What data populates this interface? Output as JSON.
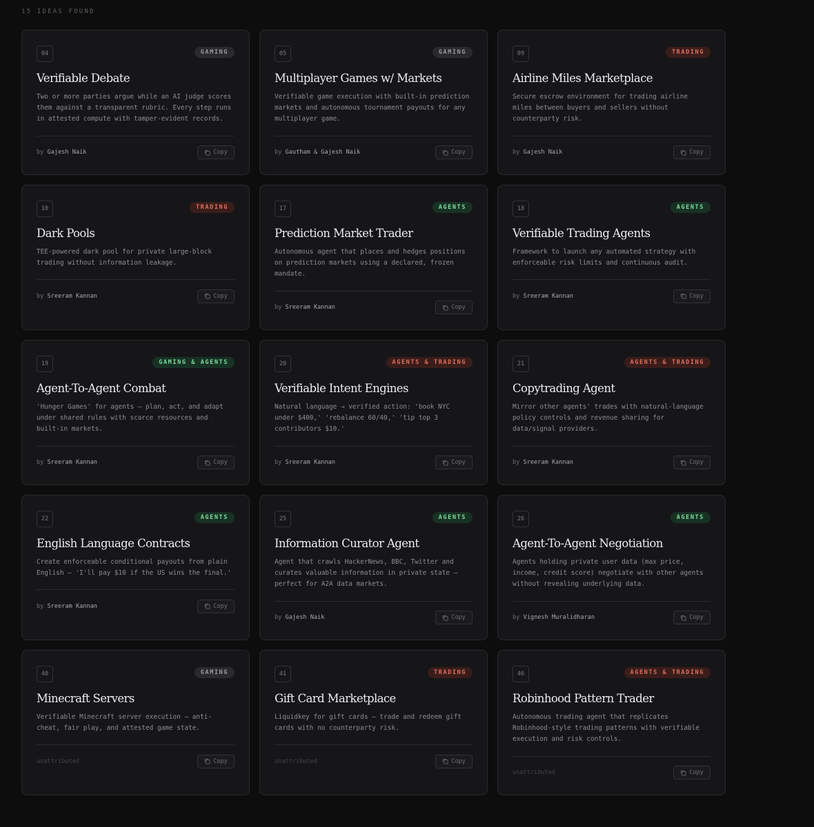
{
  "results": {
    "count_label": "15 IDEAS FOUND"
  },
  "copy_label": "Copy",
  "by_label": "by",
  "cards": [
    {
      "num": "04",
      "tag": "GAMING",
      "tag_style": "gaming",
      "title": "Verifiable Debate",
      "desc": "Two or more parties argue while an AI judge scores them against a transparent rubric. Every step runs in attested compute with tamper-evident records.",
      "author": "Gajesh Naik",
      "attributed": true
    },
    {
      "num": "05",
      "tag": "GAMING",
      "tag_style": "gaming",
      "title": "Multiplayer Games w/ Markets",
      "desc": "Verifiable game execution with built-in prediction markets and autonomous tournament payouts for any multiplayer game.",
      "author": "Gautham & Gajesh Naik",
      "attributed": true
    },
    {
      "num": "09",
      "tag": "TRADING",
      "tag_style": "trading",
      "title": "Airline Miles Marketplace",
      "desc": "Secure escrow environment for trading airline miles between buyers and sellers without counterparty risk.",
      "author": "Gajesh Naik",
      "attributed": true
    },
    {
      "num": "10",
      "tag": "TRADING",
      "tag_style": "trading",
      "title": "Dark Pools",
      "desc": "TEE-powered dark pool for private large-block trading without information leakage.",
      "author": "Sreeram Kannan",
      "attributed": true
    },
    {
      "num": "17",
      "tag": "AGENTS",
      "tag_style": "agents",
      "title": "Prediction Market Trader",
      "desc": "Autonomous agent that places and hedges positions on prediction markets using a declared, frozen mandate.",
      "author": "Sreeram Kannan",
      "attributed": true
    },
    {
      "num": "18",
      "tag": "AGENTS",
      "tag_style": "agents",
      "title": "Verifiable Trading Agents",
      "desc": "Framework to launch any automated strategy with enforceable risk limits and continuous audit.",
      "author": "Sreeram Kannan",
      "attributed": true
    },
    {
      "num": "19",
      "tag": "GAMING & AGENTS",
      "tag_style": "gaming-agents",
      "title": "Agent-To-Agent Combat",
      "desc": "'Hunger Games' for agents — plan, act, and adapt under shared rules with scarce resources and built-in markets.",
      "author": "Sreeram Kannan",
      "attributed": true
    },
    {
      "num": "20",
      "tag": "AGENTS & TRADING",
      "tag_style": "agents-trading",
      "title": "Verifiable Intent Engines",
      "desc": "Natural language → verified action: 'book NYC under $400,' 'rebalance 60/40,' 'tip top 3 contributors $10.'",
      "author": "Sreeram Kannan",
      "attributed": true
    },
    {
      "num": "21",
      "tag": "AGENTS & TRADING",
      "tag_style": "agents-trading",
      "title": "Copytrading Agent",
      "desc": "Mirror other agents' trades with natural-language policy controls and revenue sharing for data/signal providers.",
      "author": "Sreeram Kannan",
      "attributed": true
    },
    {
      "num": "22",
      "tag": "AGENTS",
      "tag_style": "agents",
      "title": "English Language Contracts",
      "desc": "Create enforceable conditional payouts from plain English — 'I'll pay $10 if the US wins the final.'",
      "author": "Sreeram Kannan",
      "attributed": true
    },
    {
      "num": "25",
      "tag": "AGENTS",
      "tag_style": "agents",
      "title": "Information Curator Agent",
      "desc": "Agent that crawls HackerNews, BBC, Twitter and curates valuable information in private state — perfect for A2A data markets.",
      "author": "Gajesh Naik",
      "attributed": true
    },
    {
      "num": "26",
      "tag": "AGENTS",
      "tag_style": "agents",
      "title": "Agent-To-Agent Negotiation",
      "desc": "Agents holding private user data (max price, income, credit score) negotiate with other agents without revealing underlying data.",
      "author": "Vignesh Muralidharan",
      "attributed": true
    },
    {
      "num": "40",
      "tag": "GAMING",
      "tag_style": "gaming",
      "title": "Minecraft Servers",
      "desc": "Verifiable Minecraft server execution — anti-cheat, fair play, and attested game state.",
      "author": "unattributed",
      "attributed": false
    },
    {
      "num": "41",
      "tag": "TRADING",
      "tag_style": "trading",
      "title": "Gift Card Marketplace",
      "desc": "Liquidkey for gift cards — trade and redeem gift cards with no counterparty risk.",
      "author": "unattributed",
      "attributed": false
    },
    {
      "num": "46",
      "tag": "AGENTS & TRADING",
      "tag_style": "agents-trading",
      "title": "Robinhood Pattern Trader",
      "desc": "Autonomous trading agent that replicates Robinhood-style trading patterns with verifiable execution and risk controls.",
      "author": "unattributed",
      "attributed": false
    }
  ]
}
